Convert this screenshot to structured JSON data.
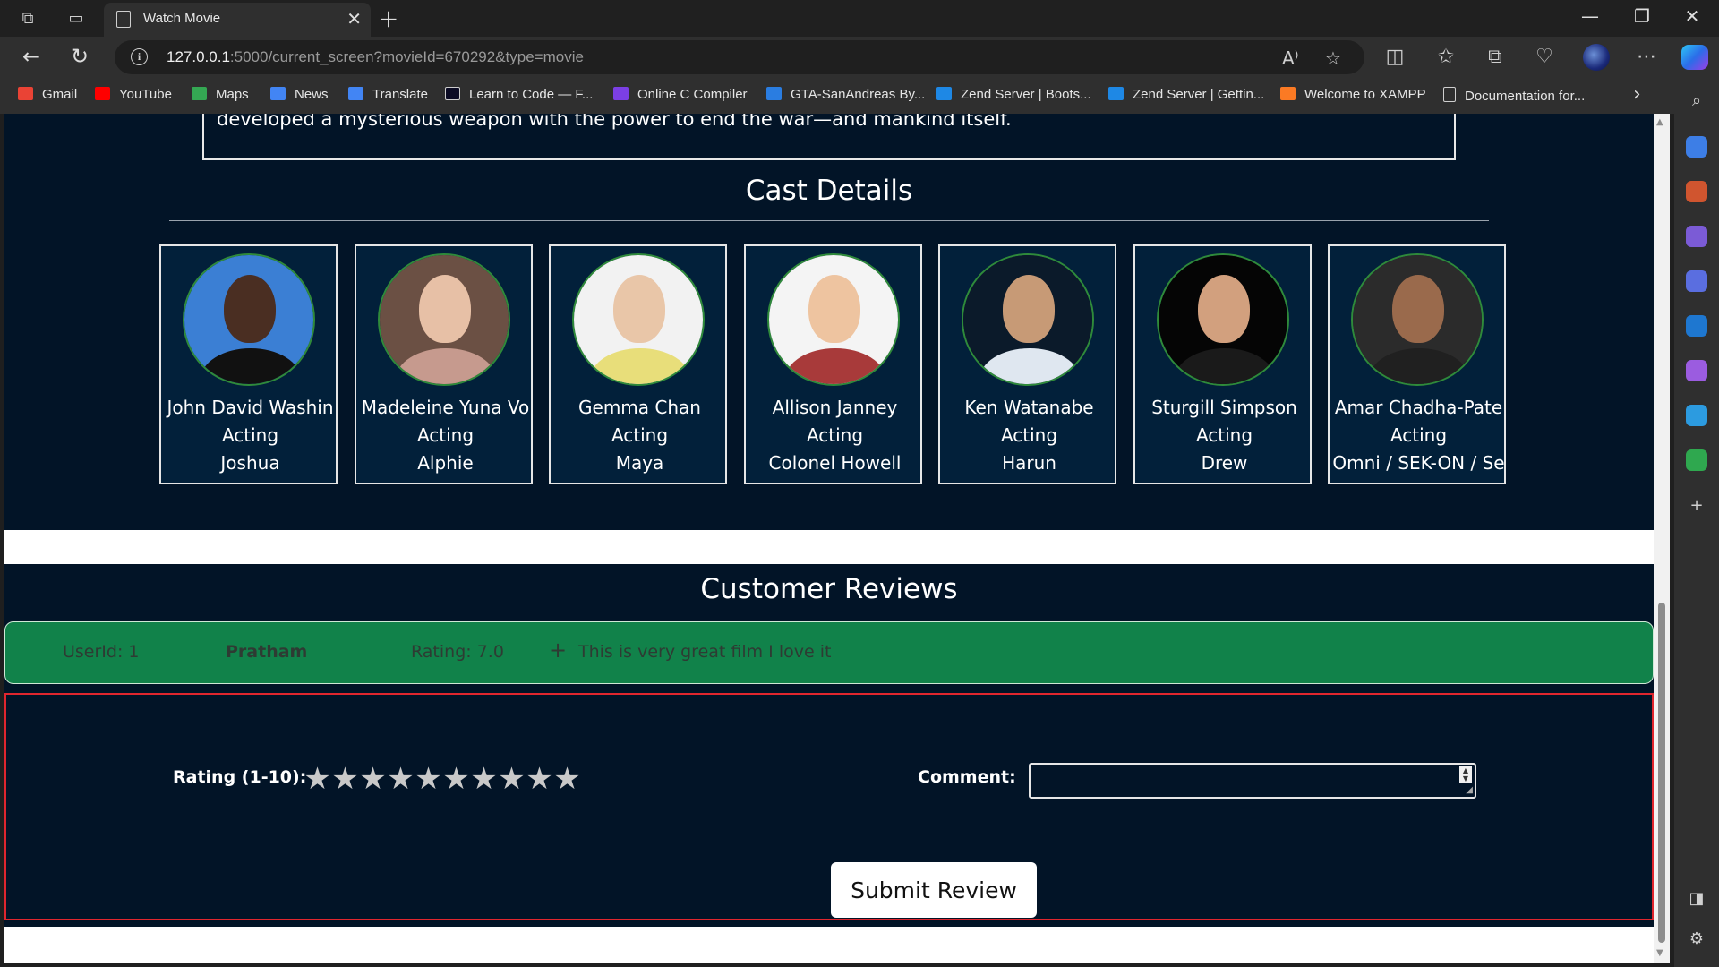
{
  "browser": {
    "tab_title": "Watch Movie",
    "url_host": "127.0.0.1",
    "url_rest": ":5000/current_screen?movieId=670292&type=movie",
    "bookmarks": [
      {
        "label": "Gmail",
        "color": "#ea4335"
      },
      {
        "label": "YouTube",
        "color": "#ff0000"
      },
      {
        "label": "Maps",
        "color": "#34a853"
      },
      {
        "label": "News",
        "color": "#4285f4"
      },
      {
        "label": "Translate",
        "color": "#4285f4"
      },
      {
        "label": "Learn to Code — F...",
        "color": "#0a0a23"
      },
      {
        "label": "Online C Compiler",
        "color": "#7b3fe4"
      },
      {
        "label": "GTA-SanAndreas By...",
        "color": "#2a7de1"
      },
      {
        "label": "Zend Server | Boots...",
        "color": "#1e88e5"
      },
      {
        "label": "Zend Server | Gettin...",
        "color": "#1e88e5"
      },
      {
        "label": "Welcome to XAMPP",
        "color": "#fb7a24"
      },
      {
        "label": "Documentation for...",
        "color": "#9e9e9e"
      }
    ]
  },
  "movie": {
    "overview_fragment": "developed a mysterious weapon with the power to end the war—and mankind itself."
  },
  "cast_section": {
    "title": "Cast Details",
    "members": [
      {
        "name": "John David Washin",
        "department": "Acting",
        "character": "Joshua",
        "bg": "#3b7fd4",
        "skin": "#4a2e22",
        "clothes": "#111111"
      },
      {
        "name": "Madeleine Yuna Vo",
        "department": "Acting",
        "character": "Alphie",
        "bg": "#6b5044",
        "skin": "#e7c0a6",
        "clothes": "#c69a8e"
      },
      {
        "name": "Gemma Chan",
        "department": "Acting",
        "character": "Maya",
        "bg": "#f2f2f2",
        "skin": "#e9c6a8",
        "clothes": "#e8de7a"
      },
      {
        "name": "Allison Janney",
        "department": "Acting",
        "character": "Colonel Howell",
        "bg": "#f4f4f4",
        "skin": "#eec4a0",
        "clothes": "#a83a3a"
      },
      {
        "name": "Ken Watanabe",
        "department": "Acting",
        "character": "Harun",
        "bg": "#0b1a2a",
        "skin": "#c79a76",
        "clothes": "#dfe7f0"
      },
      {
        "name": "Sturgill Simpson",
        "department": "Acting",
        "character": "Drew",
        "bg": "#050505",
        "skin": "#d2a07e",
        "clothes": "#1a1a1a"
      },
      {
        "name": "Amar Chadha-Pate",
        "department": "Acting",
        "character": "Omni / SEK-ON / Se",
        "bg": "#2b2b2b",
        "skin": "#9a6a4c",
        "clothes": "#202020"
      }
    ]
  },
  "reviews_section": {
    "title": "Customer Reviews",
    "reviews": [
      {
        "user_id": "UserId: 1",
        "username": "Pratham",
        "rating": "Rating: 7.0",
        "comment": "This is very great film I love it"
      }
    ],
    "form": {
      "rating_label": "Rating (1-10):",
      "star_count": 10,
      "comment_label": "Comment:",
      "comment_value": "",
      "submit_label": "Submit Review"
    }
  }
}
